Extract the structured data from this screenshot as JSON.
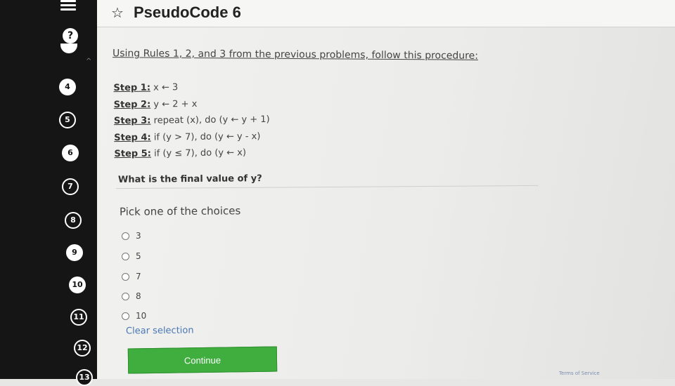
{
  "header": {
    "title": "PseudoCode 6"
  },
  "sidebar": {
    "help_label": "?",
    "questions": [
      "4",
      "5",
      "6",
      "7",
      "8",
      "9",
      "10",
      "11",
      "12",
      "13"
    ]
  },
  "content": {
    "intro": "Using Rules 1, 2, and 3 from the previous problems, follow this procedure:",
    "steps": [
      {
        "label": "Step 1:",
        "text": " x ← 3"
      },
      {
        "label": "Step 2:",
        "text": " y ← 2 + x"
      },
      {
        "label": "Step 3:",
        "text": " repeat (x), do (y ← y + 1)"
      },
      {
        "label": "Step 4:",
        "text": " if (y > 7), do (y ← y - x)"
      },
      {
        "label": "Step 5:",
        "text": " if (y ≤ 7), do (y ← x)"
      }
    ],
    "question": "What is the final value of y?",
    "prompt": "Pick one of the choices",
    "choices": [
      "3",
      "5",
      "7",
      "8",
      "10"
    ],
    "clear_label": "Clear selection",
    "continue_label": "Continue"
  },
  "footer": {
    "terms_label": "Terms of Service"
  }
}
